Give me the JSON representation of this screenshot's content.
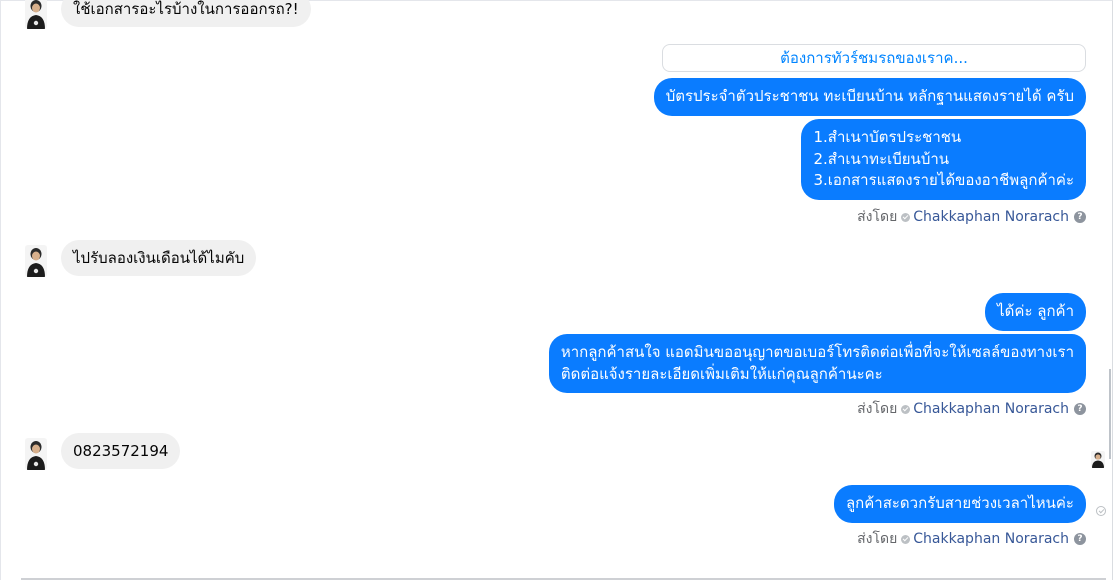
{
  "messages": {
    "incoming": [
      {
        "text": "ใช้เอกสารอะไรบ้างในการออกรถ?!"
      },
      {
        "text": "ไปรับลองเงินเดือนได้ไมคับ"
      },
      {
        "text": "0823572194"
      }
    ],
    "quick_reply": "ต้องการทัวร์ชมรถของเราค...",
    "outgoing": {
      "m1": "บัตรประจำตัวประชาชน ทะเบียนบ้าน หลักฐานแสดงรายได้ ครับ",
      "m2": [
        "1.สำเนาบัตรประชาชน",
        "2.สำเนาทะเบียนบ้าน",
        "3.เอกสารแสดงรายได้ของอาชีพลูกค้าค่ะ"
      ],
      "m3": "ได้ค่ะ ลูกค้า",
      "m4": [
        "หากลูกค้าสนใจ แอดมินขออนุญาตขอเบอร์โทรติดต่อเพื่อที่จะให้เซลล์ของทางเรา",
        "ติดต่อแจ้งรายละเอียดเพิ่มเติมให้แก่คุณลูกค้านะคะ"
      ],
      "m5": "ลูกค้าสะดวกรับสายช่วงเวลาไหนค่ะ"
    }
  },
  "sent_by": {
    "prefix": "ส่งโดย",
    "name": "Chakkaphan Norarach",
    "help_glyph": "?"
  },
  "icons": {
    "verified": "verified-check-icon",
    "help": "question-mark-icon",
    "delivered": "delivered-check-icon"
  },
  "colors": {
    "outgoing_bubble": "#0a7cff",
    "incoming_bubble": "#f0f0f0",
    "link": "#385898"
  }
}
